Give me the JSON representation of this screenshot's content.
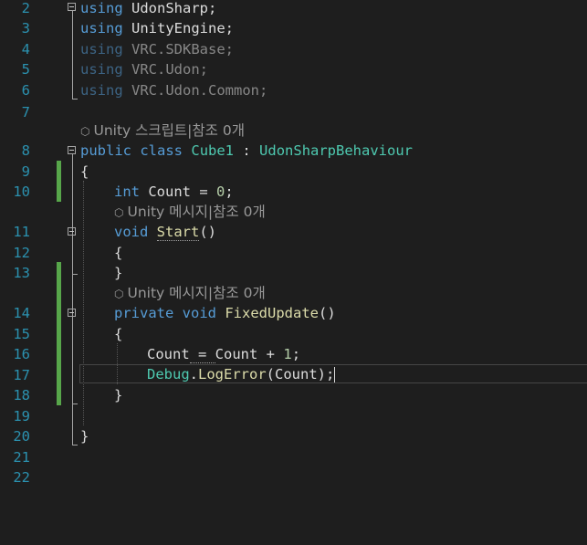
{
  "line_numbers": [
    "2",
    "3",
    "4",
    "5",
    "6",
    "7",
    "8",
    "9",
    "10",
    "11",
    "12",
    "13",
    "14",
    "15",
    "16",
    "17",
    "18",
    "19",
    "20",
    "21",
    "22"
  ],
  "codelens": {
    "class_refs": "Unity 스크립트|참조 0개",
    "start_refs": "Unity 메시지|참조 0개",
    "fixed_refs": "Unity 메시지|참조 0개"
  },
  "code": {
    "using_kw": "using",
    "ns1": "UdonSharp;",
    "ns2": "UnityEngine;",
    "ns3": "VRC.SDKBase;",
    "ns4": "VRC.Udon;",
    "ns5": "VRC.Udon.Common;",
    "public_kw": "public",
    "class_kw": "class",
    "class_name": "Cube1",
    "colon": " : ",
    "base_class": "UdonSharpBehaviour",
    "open_brace": "{",
    "close_brace": "}",
    "int_kw": "int",
    "count_decl": " Count = ",
    "zero": "0",
    "semicolon": ";",
    "void_kw": "void",
    "start_name": "Start",
    "parens": "()",
    "private_kw": "private",
    "fixed_name": "FixedUpdate",
    "count_a": "Count",
    "assign": " = ",
    "count_b": "Count",
    "plus": " + ",
    "one": "1",
    "debug_cls": "Debug",
    "dot": ".",
    "logerror": "LogError",
    "log_args": "(Count);"
  },
  "colors": {
    "keyword": "#569cd6",
    "type": "#4ec9b0",
    "method": "#dcdcaa",
    "line_number": "#2b91af",
    "change_bar": "#57a64a",
    "background": "#1e1e1e"
  },
  "icons": {
    "codelens": "cube-icon",
    "fold": "collapse-icon"
  }
}
